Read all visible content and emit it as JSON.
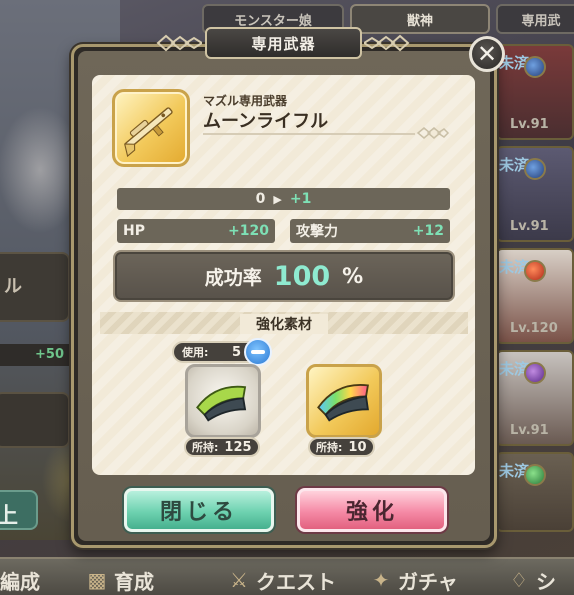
{
  "background": {
    "tabs": [
      "モンスター娘",
      "獣神",
      "専用武"
    ],
    "left_panel_text": "ル",
    "left_stat": "+50",
    "left_button": "上",
    "cards": [
      {
        "label": "未済",
        "level": "Lv.91"
      },
      {
        "label": "未済",
        "level": "Lv.91"
      },
      {
        "label": "未済",
        "level": "Lv.120"
      },
      {
        "label": "未済",
        "level": "Lv.91"
      },
      {
        "label": "未済",
        "level": ""
      }
    ],
    "nav": [
      {
        "label": "編成",
        "icon": "formation-icon"
      },
      {
        "label": "育成",
        "icon": "book-icon"
      },
      {
        "label": "クエスト",
        "icon": "swords-icon"
      },
      {
        "label": "ガチャ",
        "icon": "gacha-icon"
      },
      {
        "label": "シ",
        "icon": "shop-icon"
      }
    ]
  },
  "modal": {
    "title": "専用武器",
    "close_icon": "close-icon",
    "weapon": {
      "subtitle": "マズル専用武器",
      "name": "ムーンライフル"
    },
    "level": {
      "current": "0",
      "increase": "+1"
    },
    "stats": [
      {
        "label": "HP",
        "value": "+120"
      },
      {
        "label": "攻撃力",
        "value": "+12"
      }
    ],
    "success": {
      "label": "成功率",
      "value": "100",
      "unit": "%"
    },
    "materials_title": "強化素材",
    "use": {
      "label": "使用:",
      "count": "5"
    },
    "materials": [
      {
        "owned_label": "所持:",
        "owned": "125"
      },
      {
        "owned_label": "所持:",
        "owned": "10"
      }
    ],
    "buttons": {
      "close": "閉じる",
      "enhance": "強化"
    }
  },
  "colors": {
    "accent_green": "#7ee0b5",
    "close_button": "#6ed2b0",
    "enhance_button": "#f58aa6",
    "gold_frame": "#c9a24a"
  }
}
